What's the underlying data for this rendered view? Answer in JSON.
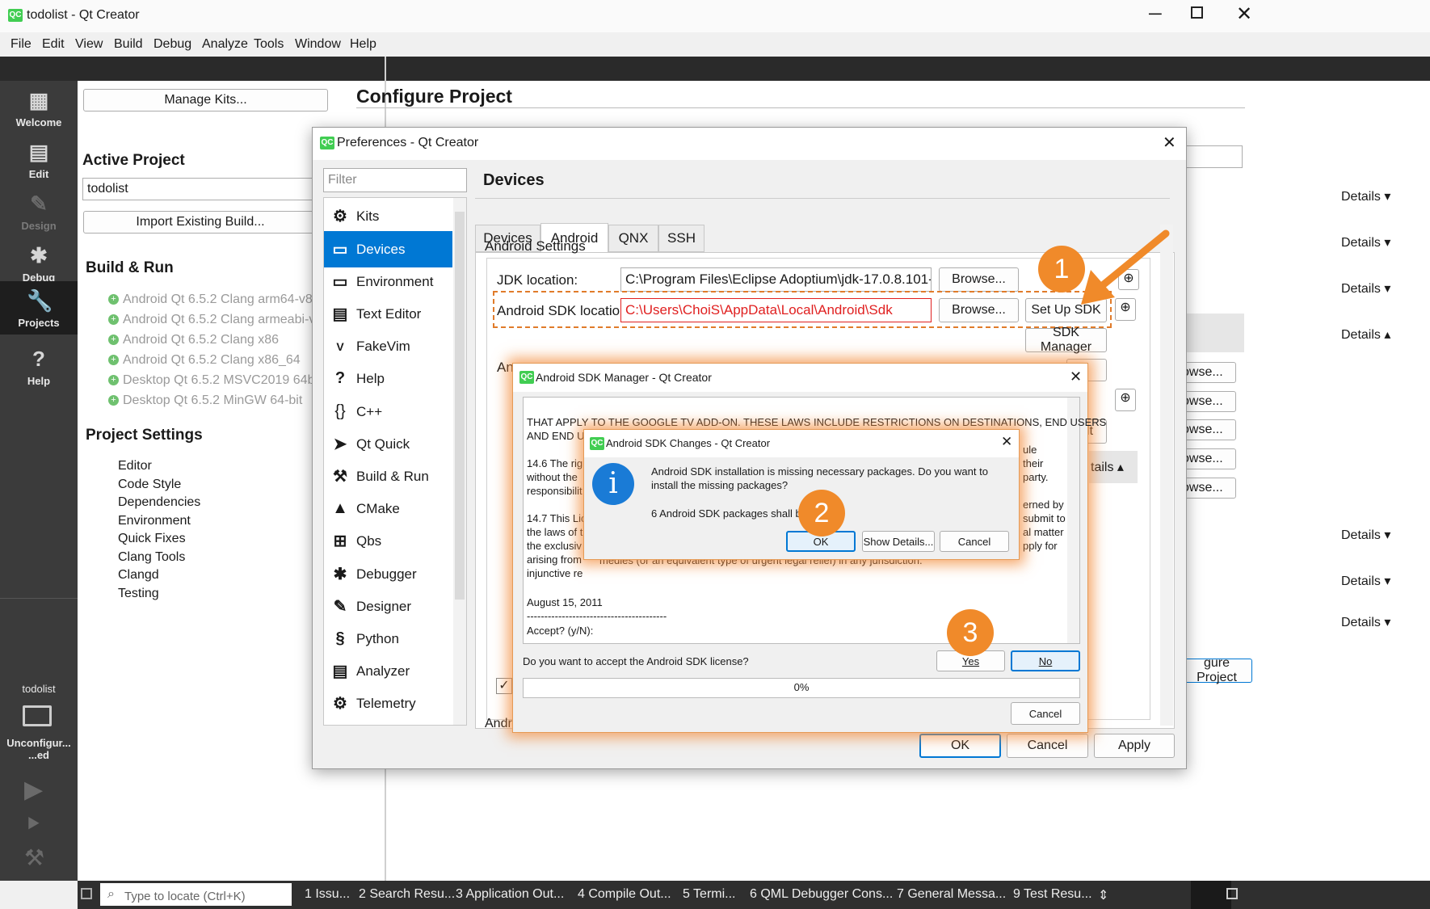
{
  "window": {
    "title": "todolist - Qt Creator",
    "icon": "QC"
  },
  "menu": [
    "File",
    "Edit",
    "View",
    "Build",
    "Debug",
    "Analyze",
    "Tools",
    "Window",
    "Help"
  ],
  "modes": [
    {
      "label": "Welcome",
      "icon": "grid-icon"
    },
    {
      "label": "Edit",
      "icon": "document-icon"
    },
    {
      "label": "Design",
      "icon": "pencil-icon"
    },
    {
      "label": "Debug",
      "icon": "bug-icon"
    },
    {
      "label": "Projects",
      "icon": "wrench-icon"
    },
    {
      "label": "Help",
      "icon": "question-icon"
    }
  ],
  "kit_selector": {
    "project": "todolist",
    "build": "Unconfigur...\n...ed"
  },
  "left": {
    "manage_kits": "Manage Kits...",
    "active_project_heading": "Active Project",
    "project_value": "todolist",
    "import_build": "Import Existing Build...",
    "build_run_heading": "Build & Run",
    "kits": [
      "Android Qt 6.5.2 Clang arm64-v8a",
      "Android Qt 6.5.2 Clang armeabi-v7a",
      "Android Qt 6.5.2 Clang x86",
      "Android Qt 6.5.2 Clang x86_64",
      "Desktop Qt 6.5.2 MSVC2019 64bit",
      "Desktop Qt 6.5.2 MinGW 64-bit"
    ],
    "project_settings_heading": "Project Settings",
    "project_settings": [
      "Editor",
      "Code Style",
      "Dependencies",
      "Environment",
      "Quick Fixes",
      "Clang Tools",
      "Clangd",
      "Testing"
    ]
  },
  "right": {
    "title": "Configure Project",
    "details": "Details",
    "configure_button": "gure Project",
    "browse_partial": "owse..."
  },
  "preferences": {
    "title": "Preferences - Qt Creator",
    "filter_placeholder": "Filter",
    "section_title": "Devices",
    "nav": [
      {
        "label": "Kits",
        "icon": "kits-icon"
      },
      {
        "label": "Devices",
        "icon": "monitor-icon"
      },
      {
        "label": "Environment",
        "icon": "monitor-icon"
      },
      {
        "label": "Text Editor",
        "icon": "text-editor-icon"
      },
      {
        "label": "FakeVim",
        "icon": "fakevim-icon"
      },
      {
        "label": "Help",
        "icon": "question-icon"
      },
      {
        "label": "C++",
        "icon": "braces-icon"
      },
      {
        "label": "Qt Quick",
        "icon": "paper-plane-icon"
      },
      {
        "label": "Build & Run",
        "icon": "hammer-icon"
      },
      {
        "label": "CMake",
        "icon": "cmake-icon"
      },
      {
        "label": "Qbs",
        "icon": "qbs-icon"
      },
      {
        "label": "Debugger",
        "icon": "bug-icon"
      },
      {
        "label": "Designer",
        "icon": "pencil-icon"
      },
      {
        "label": "Python",
        "icon": "python-icon"
      },
      {
        "label": "Analyzer",
        "icon": "analyzer-icon"
      },
      {
        "label": "Telemetry",
        "icon": "telemetry-icon"
      }
    ],
    "tabs": [
      "Devices",
      "Android",
      "QNX",
      "SSH"
    ],
    "android_settings": "Android Settings",
    "jdk_label": "JDK location:",
    "jdk_value": "C:\\Program Files\\Eclipse Adoptium\\jdk-17.0.8.101-hotspo",
    "sdk_label": "Android SDK location:",
    "sdk_value": "C:\\Users\\ChoiS\\AppData\\Local\\Android\\Sdk",
    "browse": "Browse...",
    "setup_sdk": "Set Up SDK",
    "sdk_manager": "SDK Manager",
    "ndk_partial": "An",
    "ult_partial": "ult",
    "tails_partial": "tails",
    "andr_partial": "Andr",
    "ok": "OK",
    "cancel": "Cancel",
    "apply": "Apply"
  },
  "sdk_manager": {
    "title": "Android SDK Manager - Qt Creator",
    "license_lines": [
      "THAT APPLY TO THE GOOGLE TV ADD-ON. THESE LAWS INCLUDE RESTRICTIONS ON DESTINATIONS, END USERS",
      "AND END USE.",
      "",
      "14.6 The rigl",
      "without the",
      "responsibilit",
      "",
      "14.7 This Lic",
      "the laws of t",
      "the exclusiv",
      "arising from",
      "injunctive re"
    ],
    "right_fragments": [
      "ule",
      "their",
      "party.",
      "erned by",
      "submit to",
      "al matter",
      "pply for"
    ],
    "bottom_line": "medies (or an equivalent type of urgent legal relief) in any jurisdiction.",
    "date": "August 15, 2011",
    "separator": "----------------------------------------",
    "accept_prompt": "Accept? (y/N):",
    "question": "Do you want to accept the Android SDK license?",
    "yes": "Yes",
    "no": "No",
    "progress": "0%",
    "progress_value": 0,
    "cancel": "Cancel"
  },
  "sdk_changes": {
    "title": "Android SDK Changes - Qt Creator",
    "message_1": "Android SDK installation is missing necessary packages. Do you want to",
    "message_2": "install the missing packages?",
    "message_3": "6 Android SDK packages shall be",
    "message_3_tail": "d.",
    "ok": "OK",
    "show_details": "Show Details...",
    "cancel": "Cancel"
  },
  "annotations": {
    "step1": "1",
    "step2": "2",
    "step3": "3",
    "accent": "#f08a2a"
  },
  "statusbar": {
    "locate_placeholder": "Type to locate (Ctrl+K)",
    "panes": [
      "1  Issu...",
      "2  Search Resu...",
      "3  Application Out...",
      "4  Compile Out...",
      "5  Termi...",
      "6  QML Debugger Cons...",
      "7  General Messa...",
      "9  Test Resu..."
    ]
  }
}
